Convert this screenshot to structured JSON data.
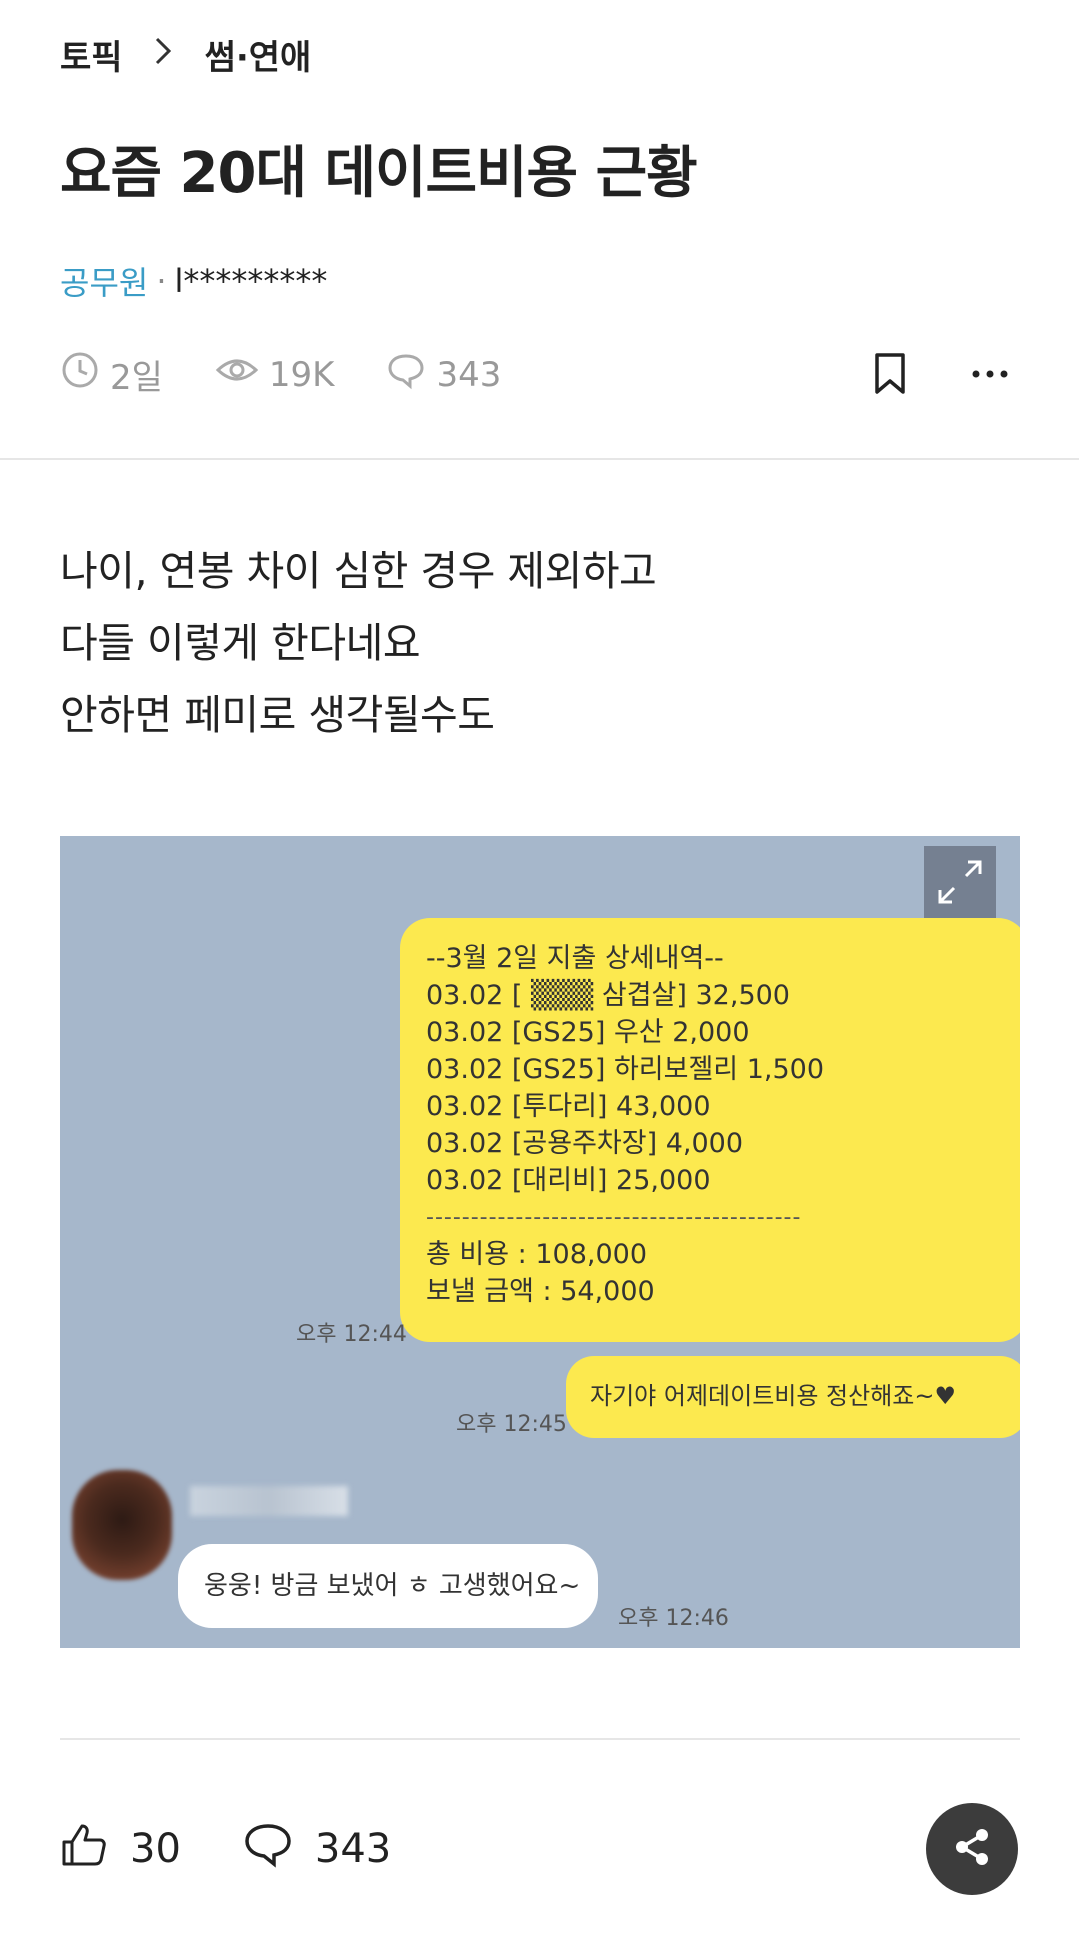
{
  "breadcrumb": {
    "root": "토픽",
    "current": "썸·연애"
  },
  "post": {
    "title": "요즘 20대 데이트비용 근황",
    "author_company": "공무원",
    "separator": "·",
    "author_masked": "l*********",
    "time": "2일",
    "views": "19K",
    "comments": "343",
    "body_lines": [
      "나이, 연봉 차이 심한 경우 제외하고",
      "다들 이렇게 한다네요",
      "안하면 페미로 생각될수도"
    ]
  },
  "image": {
    "bubble_lines": [
      "--3월 2일 지출 상세내역--",
      "03.02 [ ▒▒▒ 삼겹살] 32,500",
      "03.02 [GS25] 우산 2,000",
      "03.02 [GS25] 하리보젤리 1,500",
      "03.02 [투다리] 43,000",
      "03.02 [공용주차장] 4,000",
      "03.02 [대리비] 25,000"
    ],
    "dash_line": "------------------------------------------",
    "total_line": "총 비용 : 108,000",
    "send_line": "보낼 금액 : 54,000",
    "time1": "오후 12:44",
    "message2": "자기야 어제데이트비용 정산해죠~♥",
    "time2": "오후 12:45",
    "reply": "웅웅! 방금 보냈어 ㅎ 고생했어요~",
    "time3": "오후 12:46"
  },
  "footer": {
    "likes": "30",
    "comments": "343"
  },
  "icons": [
    "chevron-right-icon",
    "clock-icon",
    "eye-icon",
    "comment-icon",
    "bookmark-icon",
    "more-icon",
    "expand-icon",
    "thumbs-up-icon",
    "share-icon"
  ]
}
